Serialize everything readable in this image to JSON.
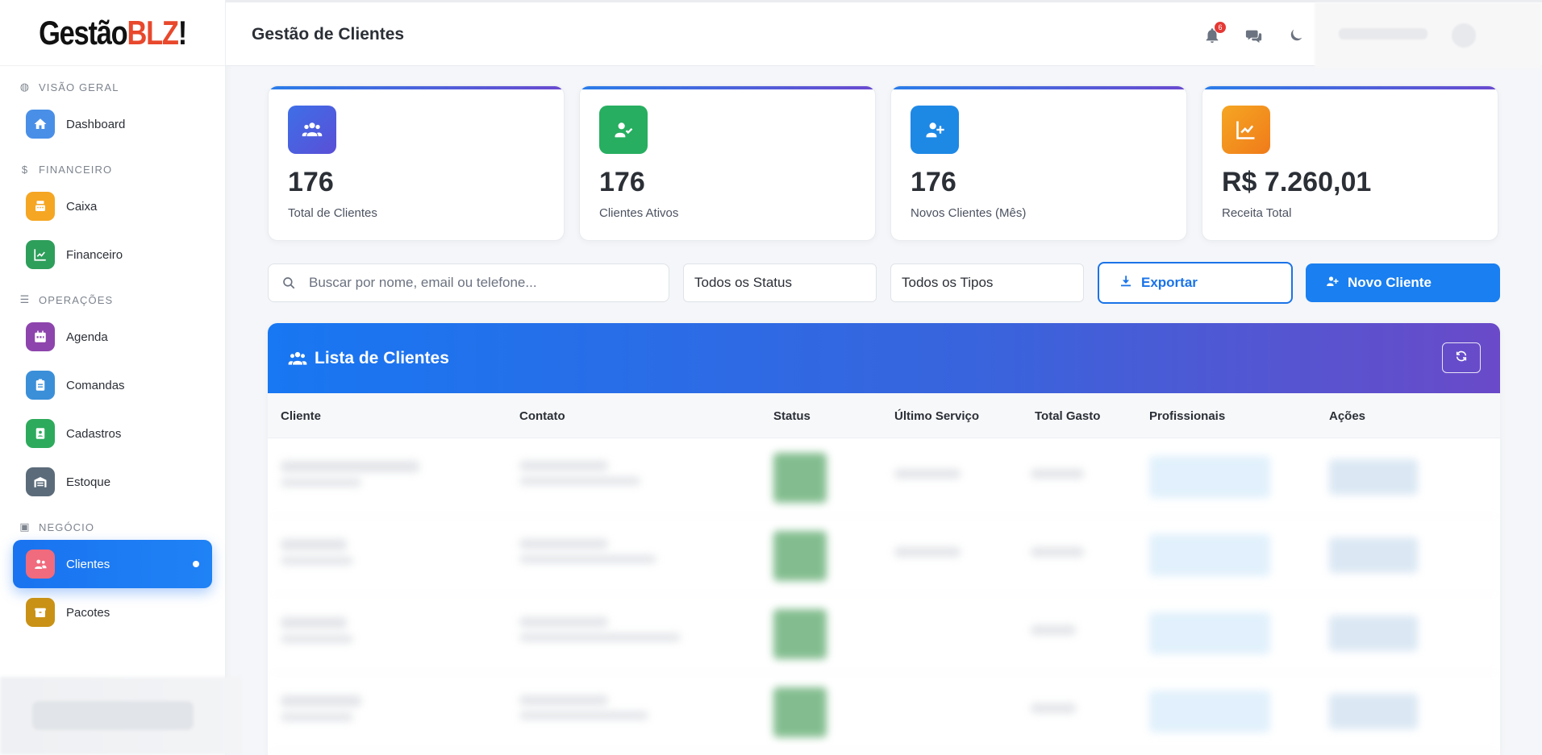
{
  "brand": {
    "part1": "Gestão",
    "part2": "BLZ",
    "part3": "!"
  },
  "sidebar": {
    "sections": [
      {
        "label": "VISÃO GERAL",
        "icon": "palette-icon"
      },
      {
        "label": "FINANCEIRO",
        "icon": "dollar-icon"
      },
      {
        "label": "OPERAÇÕES",
        "icon": "tasks-icon"
      },
      {
        "label": "NEGÓCIO",
        "icon": "briefcase-icon"
      }
    ],
    "items": [
      {
        "label": "Dashboard",
        "icon": "home-icon",
        "color": "#4a8fe7"
      },
      {
        "label": "Caixa",
        "icon": "cash-register-icon",
        "color": "#f5a623"
      },
      {
        "label": "Financeiro",
        "icon": "chart-line-icon",
        "color": "#2e9e5b"
      },
      {
        "label": "Agenda",
        "icon": "calendar-icon",
        "color": "#8e44ad"
      },
      {
        "label": "Comandas",
        "icon": "clipboard-icon",
        "color": "#3b8fd9"
      },
      {
        "label": "Cadastros",
        "icon": "address-book-icon",
        "color": "#2eaa5c"
      },
      {
        "label": "Estoque",
        "icon": "warehouse-icon",
        "color": "#5b6b7a"
      },
      {
        "label": "Clientes",
        "icon": "users-icon",
        "color": "#f06b7d",
        "active": true
      },
      {
        "label": "Pacotes",
        "icon": "box-icon",
        "color": "#c99216"
      }
    ]
  },
  "header": {
    "title": "Gestão de Clientes",
    "notification_count": "6"
  },
  "stats": [
    {
      "value": "176",
      "label": "Total de Clientes",
      "icon": "users-icon",
      "color": "#4a5fe0"
    },
    {
      "value": "176",
      "label": "Clientes Ativos",
      "icon": "user-check-icon",
      "color": "#27ae60"
    },
    {
      "value": "176",
      "label": "Novos Clientes (Mês)",
      "icon": "user-plus-icon",
      "color": "#1e88e5"
    },
    {
      "value": "R$ 7.260,01",
      "label": "Receita Total",
      "icon": "chart-line-icon",
      "color": "#f39c12"
    }
  ],
  "toolbar": {
    "search_placeholder": "Buscar por nome, email ou telefone...",
    "status_filter": "Todos os Status",
    "type_filter": "Todos os Tipos",
    "export_label": "Exportar",
    "new_label": "Novo Cliente"
  },
  "table": {
    "title": "Lista de Clientes",
    "columns": [
      "Cliente",
      "Contato",
      "Status",
      "Último Serviço",
      "Total Gasto",
      "Profissionais",
      "Ações"
    ]
  },
  "colors": {
    "primary": "#1a73e8",
    "active_nav": "#1a73f0",
    "danger": "#e53935"
  }
}
